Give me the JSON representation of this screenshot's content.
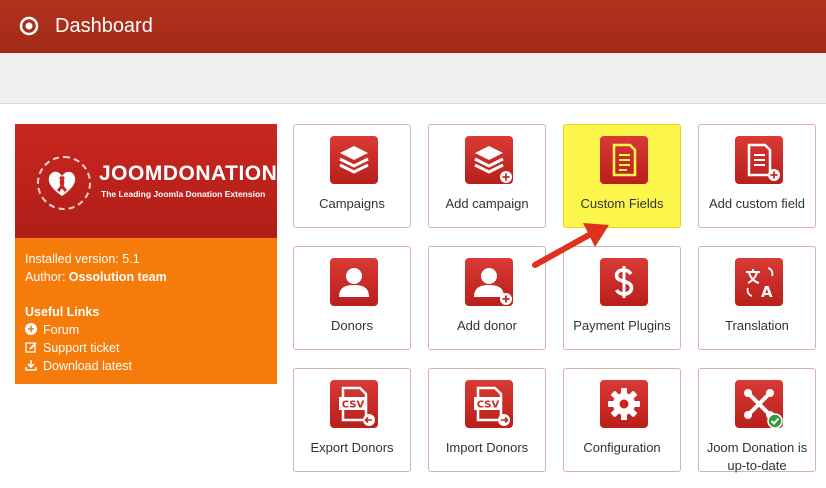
{
  "header": {
    "title": "Dashboard"
  },
  "info": {
    "brand_name": "JOOMDONATION",
    "brand_tagline": "The Leading Joomla Donation Extension",
    "installed_version": "Installed version: 5.1",
    "author_label": "Author:",
    "author_name": "Ossolution team",
    "useful_links_title": "Useful Links",
    "links": [
      "Forum",
      "Support ticket",
      "Download latest"
    ]
  },
  "tiles": [
    {
      "label": "Campaigns",
      "icon": "layers-icon"
    },
    {
      "label": "Add campaign",
      "icon": "layers-add-icon"
    },
    {
      "label": "Custom Fields",
      "icon": "document-icon"
    },
    {
      "label": "Add custom field",
      "icon": "document-add-icon"
    },
    {
      "label": "Donors",
      "icon": "user-icon"
    },
    {
      "label": "Add donor",
      "icon": "user-add-icon"
    },
    {
      "label": "Payment Plugins",
      "icon": "dollar-icon"
    },
    {
      "label": "Translation",
      "icon": "translate-icon"
    },
    {
      "label": "Export Donors",
      "icon": "csv-export-icon"
    },
    {
      "label": "Import Donors",
      "icon": "csv-import-icon"
    },
    {
      "label": "Configuration",
      "icon": "gear-icon"
    },
    {
      "label": "Joom Donation is up-to-date",
      "icon": "joomla-check-icon"
    }
  ],
  "colors": {
    "header": "#a82d19",
    "orange": "#f57b0a",
    "tile_icon": "#c8261f",
    "highlight": "#fcf64a"
  },
  "icons": {
    "csv_text": "CSV",
    "translate_glyph": "A"
  }
}
